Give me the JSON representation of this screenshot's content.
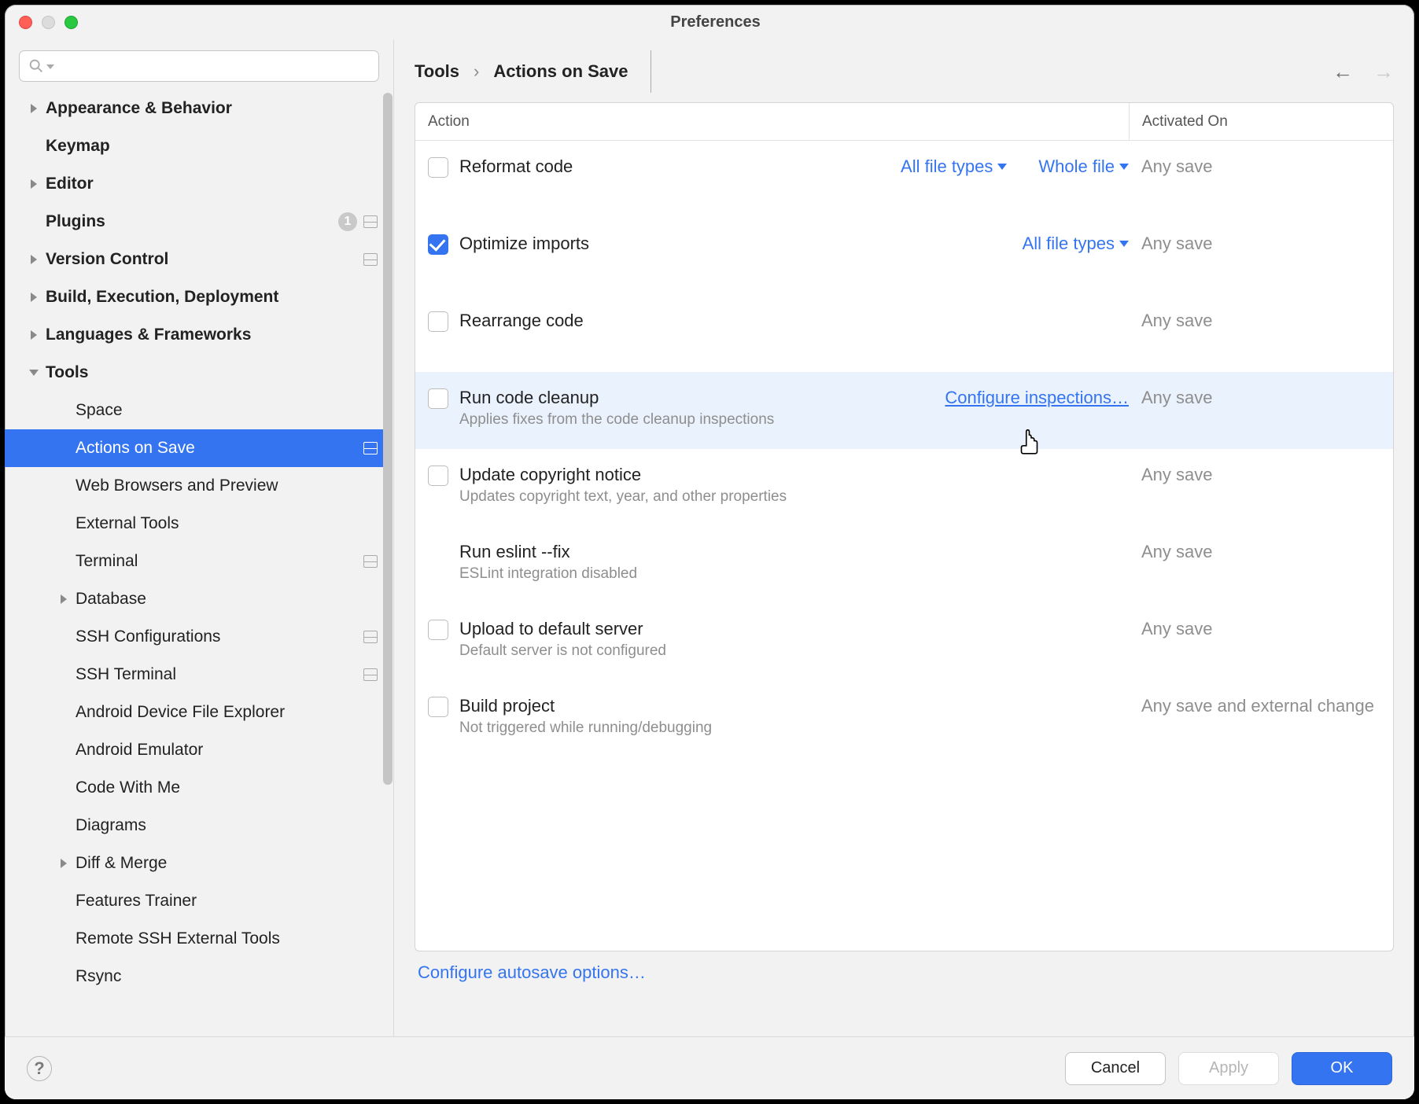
{
  "title": "Preferences",
  "sidebar": {
    "items": [
      {
        "label": "Appearance & Behavior",
        "bold": true,
        "arrow": "right"
      },
      {
        "label": "Keymap",
        "bold": true
      },
      {
        "label": "Editor",
        "bold": true,
        "arrow": "right"
      },
      {
        "label": "Plugins",
        "bold": true,
        "badge_count": "1",
        "sep": true
      },
      {
        "label": "Version Control",
        "bold": true,
        "arrow": "right",
        "sep": true
      },
      {
        "label": "Build, Execution, Deployment",
        "bold": true,
        "arrow": "right"
      },
      {
        "label": "Languages & Frameworks",
        "bold": true,
        "arrow": "right"
      },
      {
        "label": "Tools",
        "bold": true,
        "arrow": "down"
      },
      {
        "label": "Space",
        "level": 2
      },
      {
        "label": "Actions on Save",
        "level": 2,
        "selected": true,
        "sep": true
      },
      {
        "label": "Web Browsers and Preview",
        "level": 2
      },
      {
        "label": "External Tools",
        "level": 2
      },
      {
        "label": "Terminal",
        "level": 2,
        "sep": true
      },
      {
        "label": "Database",
        "level": 2,
        "arrow": "right"
      },
      {
        "label": "SSH Configurations",
        "level": 2,
        "sep": true
      },
      {
        "label": "SSH Terminal",
        "level": 2,
        "sep": true
      },
      {
        "label": "Android Device File Explorer",
        "level": 2
      },
      {
        "label": "Android Emulator",
        "level": 2
      },
      {
        "label": "Code With Me",
        "level": 2
      },
      {
        "label": "Diagrams",
        "level": 2
      },
      {
        "label": "Diff & Merge",
        "level": 2,
        "arrow": "right"
      },
      {
        "label": "Features Trainer",
        "level": 2
      },
      {
        "label": "Remote SSH External Tools",
        "level": 2
      },
      {
        "label": "Rsync",
        "level": 2
      }
    ]
  },
  "breadcrumb": {
    "parent": "Tools",
    "current": "Actions on Save"
  },
  "columns": {
    "action": "Action",
    "activated": "Activated On"
  },
  "rows": [
    {
      "label": "Reformat code",
      "checked": false,
      "opts": [
        "All file types",
        "Whole file"
      ],
      "activated": "Any save"
    },
    {
      "label": "Optimize imports",
      "checked": true,
      "opts": [
        "All file types"
      ],
      "activated": "Any save"
    },
    {
      "label": "Rearrange code",
      "checked": false,
      "activated": "Any save"
    },
    {
      "label": "Run code cleanup",
      "checked": false,
      "desc": "Applies fixes from the code cleanup inspections",
      "link": "Configure inspections…",
      "activated": "Any save",
      "hover": true
    },
    {
      "label": "Update copyright notice",
      "checked": false,
      "desc": "Updates copyright text, year, and other properties",
      "activated": "Any save"
    },
    {
      "label": "Run eslint --fix",
      "nocheck": true,
      "desc": "ESLint integration disabled",
      "activated": "Any save"
    },
    {
      "label": "Upload to default server",
      "checked": false,
      "desc": "Default server is not configured",
      "activated": "Any save"
    },
    {
      "label": "Build project",
      "checked": false,
      "desc": "Not triggered while running/debugging",
      "activated": "Any save and external change"
    }
  ],
  "autosave_link": "Configure autosave options…",
  "buttons": {
    "cancel": "Cancel",
    "apply": "Apply",
    "ok": "OK"
  }
}
